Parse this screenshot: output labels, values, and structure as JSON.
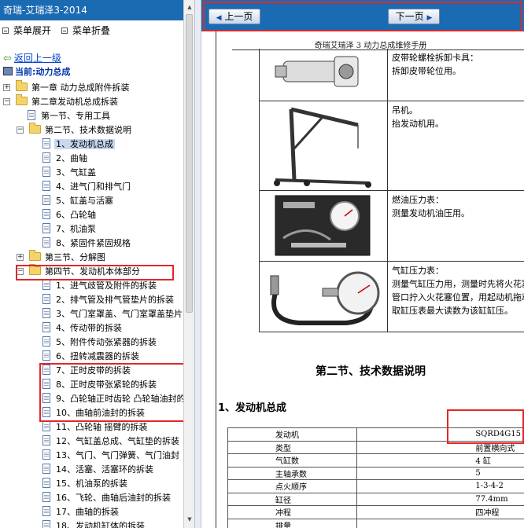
{
  "left": {
    "title": "奇瑞-艾瑞泽3-2014",
    "expand_label": "菜单展开",
    "collapse_label": "菜单折叠",
    "back_label": "返回上一级",
    "current_label": "当前:动力总成",
    "tree": [
      {
        "label": "第一章 动力总成附件拆装",
        "type": "folder",
        "pm": "+"
      },
      {
        "label": "第二章发动机总成拆装",
        "type": "folder",
        "pm": "-"
      },
      {
        "label": "第一节、专用工具",
        "type": "doc"
      },
      {
        "label": "第二节、技术数据说明",
        "type": "folder",
        "pm": "-"
      },
      {
        "label": "1、发动机总成",
        "type": "doc",
        "selected": true
      },
      {
        "label": "2、曲轴",
        "type": "doc"
      },
      {
        "label": "3、气缸盖",
        "type": "doc"
      },
      {
        "label": "4、进气门和排气门",
        "type": "doc"
      },
      {
        "label": "5、缸盖与活塞",
        "type": "doc"
      },
      {
        "label": "6、凸轮轴",
        "type": "doc"
      },
      {
        "label": "7、机油泵",
        "type": "doc"
      },
      {
        "label": "8、紧固件紧固规格",
        "type": "doc"
      },
      {
        "label": "第三节、分解图",
        "type": "folder",
        "pm": "+"
      },
      {
        "label": "第四节、发动机本体部分",
        "type": "folder",
        "pm": "-"
      },
      {
        "label": "1、进气歧管及附件的拆装",
        "type": "doc"
      },
      {
        "label": "2、排气管及排气管垫片的拆装",
        "type": "doc"
      },
      {
        "label": "3、气门室罩盖、气门室罩盖垫片",
        "type": "doc"
      },
      {
        "label": "4、传动带的拆装",
        "type": "doc"
      },
      {
        "label": "5、附件传动张紧器的拆装",
        "type": "doc"
      },
      {
        "label": "6、扭转减震器的拆装",
        "type": "doc"
      },
      {
        "label": "7、正时皮带的拆装",
        "type": "doc"
      },
      {
        "label": "8、正时皮带张紧轮的拆装",
        "type": "doc"
      },
      {
        "label": "9、凸轮轴正时齿轮 凸轮轴油封的",
        "type": "doc"
      },
      {
        "label": "10、曲轴前油封的拆装",
        "type": "doc"
      },
      {
        "label": "11、凸轮轴 摇臂的拆装",
        "type": "doc"
      },
      {
        "label": "12、气缸盖总成、气缸垫的拆装",
        "type": "doc"
      },
      {
        "label": "13、气门、气门弹簧、气门油封",
        "type": "doc"
      },
      {
        "label": "14、活塞、活塞环的拆装",
        "type": "doc"
      },
      {
        "label": "15、机油泵的拆装",
        "type": "doc"
      },
      {
        "label": "16、飞轮、曲轴后油封的拆装",
        "type": "doc"
      },
      {
        "label": "17、曲轴的拆装",
        "type": "doc"
      },
      {
        "label": "18、发动机缸体的拆装",
        "type": "doc"
      }
    ]
  },
  "nav": {
    "prev_label": "上一页",
    "next_label": "下一页"
  },
  "page": {
    "manual_title": "奇瑞艾瑞泽 3 动力总成维修手册",
    "tools": [
      {
        "lines": [
          "皮带轮螺栓拆卸卡具：",
          "拆卸皮带轮位用。"
        ]
      },
      {
        "lines": [
          "吊机。",
          "抬发动机用。"
        ]
      },
      {
        "lines": [
          "燃油压力表：",
          "测量发动机油压用。"
        ]
      },
      {
        "lines": [
          "气缸压力表：",
          "测量气缸压力用，测量时先将火花塞",
          "管口拧入火花塞位置，用起动机拖动",
          "取缸压表最大读数为该缸缸压。"
        ]
      }
    ],
    "section_title": "第二节、技术数据说明",
    "subsection_title": "1、发动机总成",
    "spec": [
      {
        "k": "发动机",
        "v": "SQRD4G15"
      },
      {
        "k": "类型",
        "v": "前置横向式"
      },
      {
        "k": "气缸数",
        "v": "4 缸"
      },
      {
        "k": "主轴承数",
        "v": "5"
      },
      {
        "k": "点火顺序",
        "v": "1-3-4-2"
      },
      {
        "k": "缸径",
        "v": "77.4mm"
      },
      {
        "k": "冲程",
        "v": "四冲程"
      },
      {
        "k": "排量",
        "v": ""
      }
    ]
  }
}
